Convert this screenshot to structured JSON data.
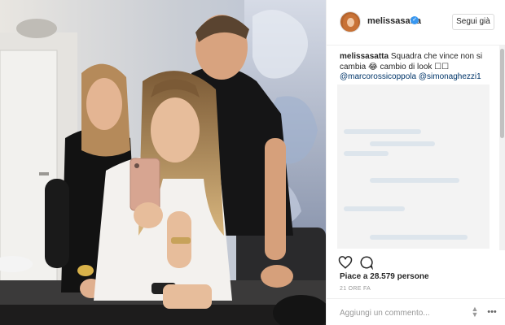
{
  "post": {
    "username": "melissasatta",
    "follow_label": "Segui già",
    "caption_user": "melissasatta",
    "caption_text": "Squadra che vince non si cambia 😂 cambio di look ☐☐",
    "mention_1": "@marcorossicoppola",
    "mention_2": "@simonaghezzi1",
    "likes": "Piace a 28.579 persone",
    "time_ago": "21 ORE FA",
    "comment_placeholder": "Aggiungi un commento..."
  },
  "icons": {
    "avatar": "profile-avatar",
    "verified": "verified-badge-icon",
    "like": "heart-icon",
    "comment": "comment-bubble-icon",
    "sort": "sort-arrows-icon",
    "more": "more-options-icon"
  },
  "colors": {
    "verified": "#3897f0",
    "mention": "#003569",
    "border": "#efefef",
    "muted": "#999999"
  }
}
